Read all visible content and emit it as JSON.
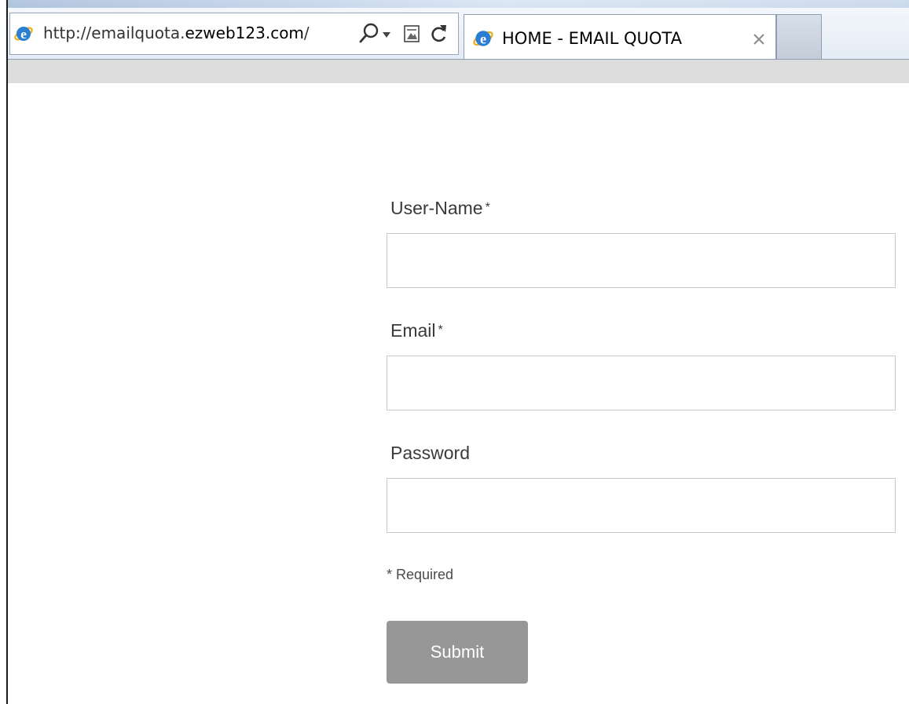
{
  "browser": {
    "address_bar": {
      "url_prefix": "http://emailquota.",
      "url_domain": "ezweb123.com",
      "url_suffix": "/"
    },
    "active_tab": {
      "title": "HOME - EMAIL QUOTA",
      "close_glyph": "×"
    },
    "icons": {
      "page_icon": "internet-explorer-icon",
      "search": "search-icon",
      "search_dropdown": "chevron-down-icon",
      "compatibility": "compatibility-view-icon",
      "refresh": "refresh-icon",
      "close": "close-icon"
    }
  },
  "form": {
    "username": {
      "label": "User-Name",
      "required_mark": "*",
      "value": ""
    },
    "email": {
      "label": "Email",
      "required_mark": "*",
      "value": ""
    },
    "password": {
      "label": "Password",
      "value": ""
    },
    "required_note": "* Required",
    "submit_label": "Submit"
  },
  "colors": {
    "submit_background": "#979797",
    "submit_text": "#ffffff",
    "input_border": "#c9c9c9",
    "command_bar": "#dcdcdc",
    "label_text": "#3a3a3a"
  }
}
